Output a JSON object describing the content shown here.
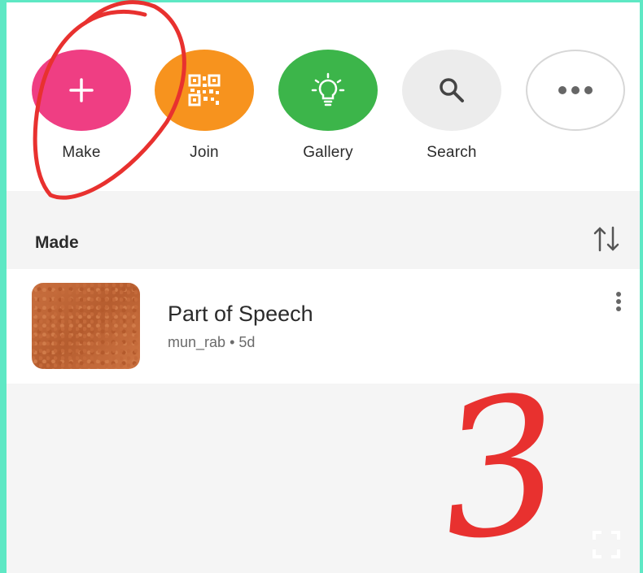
{
  "actions": [
    {
      "label": "Make",
      "icon": "plus-icon",
      "color": "#ef3e83"
    },
    {
      "label": "Join",
      "icon": "qr-code-icon",
      "color": "#f7931e"
    },
    {
      "label": "Gallery",
      "icon": "lightbulb-icon",
      "color": "#3cb54a"
    },
    {
      "label": "Search",
      "icon": "search-icon",
      "color": "#ececec"
    },
    {
      "label": "",
      "icon": "more-horizontal-icon",
      "color": "#ffffff"
    }
  ],
  "section": {
    "title": "Made"
  },
  "items": [
    {
      "title": "Part of Speech",
      "author": "mun_rab",
      "age": "5d",
      "separator": "•"
    }
  ],
  "annotation": {
    "text": "3",
    "color": "#e8312f"
  },
  "colors": {
    "frame": "#5ee8c4",
    "background": "#f5f5f5",
    "text": "#2b2b2b"
  }
}
